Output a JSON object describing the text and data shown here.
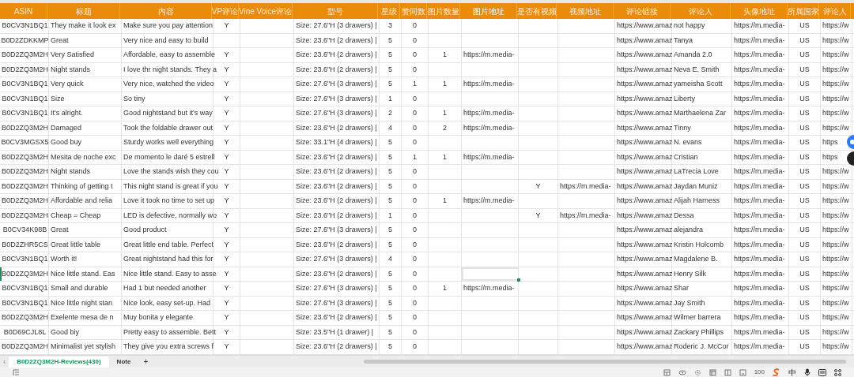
{
  "columns": [
    {
      "label": "ASIN",
      "selected": false
    },
    {
      "label": "标题",
      "selected": false
    },
    {
      "label": "内容",
      "selected": false
    },
    {
      "label": "VP评论",
      "selected": false
    },
    {
      "label": "Vine Voice评论",
      "selected": false
    },
    {
      "label": "型号",
      "selected": false
    },
    {
      "label": "星级",
      "selected": false
    },
    {
      "label": "赞同数",
      "selected": false
    },
    {
      "label": "图片数量",
      "selected": false
    },
    {
      "label": "图片地址",
      "selected": true
    },
    {
      "label": "是否有视频",
      "selected": false
    },
    {
      "label": "视频地址",
      "selected": false
    },
    {
      "label": "评论链接",
      "selected": false
    },
    {
      "label": "评论人",
      "selected": false
    },
    {
      "label": "头像地址",
      "selected": false
    },
    {
      "label": "所属国家",
      "selected": false
    },
    {
      "label": "评论人",
      "selected": false
    }
  ],
  "rows": [
    {
      "selected": false,
      "cells": [
        "B0CV3N1BQ1",
        "They make it look ex",
        "Make sure you pay attention",
        "Y",
        "",
        "Size: 27.6\"H (3 drawers) |",
        "3",
        "0",
        "",
        "",
        "",
        "",
        "https://www.amaz",
        "not happy",
        "https://m.media-",
        "US",
        "https://w"
      ]
    },
    {
      "selected": false,
      "cells": [
        "B0D2ZDKKMP",
        "Great",
        "Very nice and easy to build",
        "",
        "",
        "Size: 23.6\"H (2 drawers) |",
        "5",
        "0",
        "",
        "",
        "",
        "",
        "https://www.amaz",
        "Tanya",
        "https://m.media-",
        "US",
        "https://w"
      ]
    },
    {
      "selected": false,
      "cells": [
        "B0D2ZQ3M2H",
        "Very Satisfied",
        "Affordable, easy to assemble",
        "Y",
        "",
        "Size: 23.6\"H (2 drawers) |",
        "5",
        "0",
        "1",
        "https://m.media-",
        "",
        "",
        "https://www.amaz",
        "Amanda 2.0",
        "https://m.media-",
        "US",
        "https://w"
      ]
    },
    {
      "selected": false,
      "cells": [
        "B0D2ZQ3M2H",
        "Night stands",
        "I love thr night stands. They a",
        "Y",
        "",
        "Size: 23.6\"H (2 drawers) |",
        "5",
        "0",
        "",
        "",
        "",
        "",
        "https://www.amaz",
        "Neva E. Smith",
        "https://m.media-",
        "US",
        "https://w"
      ]
    },
    {
      "selected": false,
      "cells": [
        "B0CV3N1BQ1",
        "Very quick",
        "Very nice, watched the video",
        "Y",
        "",
        "Size: 27.6\"H (3 drawers) |",
        "5",
        "1",
        "1",
        "https://m.media-",
        "",
        "",
        "https://www.amaz",
        "yameisha Scott",
        "https://m.media-",
        "US",
        "https://w"
      ]
    },
    {
      "selected": false,
      "cells": [
        "B0CV3N1BQ1",
        "Size",
        "So tiny",
        "Y",
        "",
        "Size: 27.6\"H (3 drawers) |",
        "1",
        "0",
        "",
        "",
        "",
        "",
        "https://www.amaz",
        "Liberty",
        "https://m.media-",
        "US",
        "https://w"
      ]
    },
    {
      "selected": false,
      "cells": [
        "B0CV3N1BQ1",
        "It's alright.",
        "Good nightstand but it's way",
        "Y",
        "",
        "Size: 27.6\"H (3 drawers) |",
        "2",
        "0",
        "1",
        "https://m.media-",
        "",
        "",
        "https://www.amaz",
        "Marthaelena Zar",
        "https://m.media-",
        "US",
        "https://w"
      ]
    },
    {
      "selected": false,
      "cells": [
        "B0D2ZQ3M2H",
        "Damaged",
        "Took the foldable drawer out",
        "Y",
        "",
        "Size: 23.6\"H (2 drawers) |",
        "4",
        "0",
        "2",
        "https://m.media-",
        "",
        "",
        "https://www.amaz",
        "Tinny",
        "https://m.media-",
        "US",
        "https://w"
      ]
    },
    {
      "selected": false,
      "cells": [
        "B0CV3MGSX5",
        "Good buy",
        "Sturdy works well everything",
        "Y",
        "",
        "Size: 33.1\"H (4 drawers) |",
        "5",
        "0",
        "",
        "",
        "",
        "",
        "https://www.amaz",
        "N. evans",
        "https://m.media-",
        "US",
        "https"
      ]
    },
    {
      "selected": false,
      "cells": [
        "B0D2ZQ3M2H",
        "Mesita de noche exc",
        "De momento le daré 5 estrell",
        "Y",
        "",
        "Size: 23.6\"H (2 drawers) |",
        "5",
        "1",
        "1",
        "https://m.media-",
        "",
        "",
        "https://www.amaz",
        "Cristian",
        "https://m.media-",
        "US",
        "https"
      ]
    },
    {
      "selected": false,
      "cells": [
        "B0D2ZQ3M2H",
        "Night stands",
        "Love the stands wish they cou",
        "Y",
        "",
        "Size: 23.6\"H (2 drawers) |",
        "5",
        "0",
        "",
        "",
        "",
        "",
        "https://www.amaz",
        "LaTrecia Love",
        "https://m.media-",
        "US",
        "https://w"
      ]
    },
    {
      "selected": false,
      "cells": [
        "B0D2ZQ3M2H",
        "Thinking of getting t",
        "This night stand is great if you",
        "Y",
        "",
        "Size: 23.6\"H (2 drawers) |",
        "5",
        "0",
        "",
        "",
        "Y",
        "https://m.media-",
        "https://www.amaz",
        "Jaydan Muniz",
        "https://m.media-",
        "US",
        "https://w"
      ]
    },
    {
      "selected": false,
      "cells": [
        "B0D2ZQ3M2H",
        "Affordable and relia",
        "Love it took no time to set up",
        "Y",
        "",
        "Size: 23.6\"H (2 drawers) |",
        "5",
        "0",
        "1",
        "https://m.media-",
        "",
        "",
        "https://www.amaz",
        "Alijah Harness",
        "https://m.media-",
        "US",
        "https://w"
      ]
    },
    {
      "selected": false,
      "cells": [
        "B0D2ZQ3M2H",
        "Cheap = Cheap",
        "LED is defective, normally wo",
        "Y",
        "",
        "Size: 23.6\"H (2 drawers) |",
        "1",
        "0",
        "",
        "",
        "Y",
        "https://m.media-",
        "https://www.amaz",
        "Dessa",
        "https://m.media-",
        "US",
        "https://w"
      ]
    },
    {
      "selected": false,
      "cells": [
        "B0CV34K98B",
        "Great",
        "Good product",
        "Y",
        "",
        "Size: 27.6\"H (3 drawers) |",
        "5",
        "0",
        "",
        "",
        "",
        "",
        "https://www.amaz",
        "alejandra",
        "https://m.media-",
        "US",
        "https://w"
      ]
    },
    {
      "selected": false,
      "cells": [
        "B0D2ZHR5CS",
        "Great little table",
        "Great little end table. Perfect",
        "Y",
        "",
        "Size: 23.6\"H (2 drawers) |",
        "5",
        "0",
        "",
        "",
        "",
        "",
        "https://www.amaz",
        "Kristin Holcomb",
        "https://m.media-",
        "US",
        "https://w"
      ]
    },
    {
      "selected": false,
      "cells": [
        "B0CV3N1BQ1",
        "Worth it!",
        "Great nightstand had this for",
        "Y",
        "",
        "Size: 27.6\"H (3 drawers) |",
        "4",
        "0",
        "",
        "",
        "",
        "",
        "https://www.amaz",
        "Magdalene B.",
        "https://m.media-",
        "US",
        "https://w"
      ]
    },
    {
      "selected": true,
      "cells": [
        "B0D2ZQ3M2H",
        "Nice little stand. Eas",
        "Nice little stand. Easy to asse",
        "Y",
        "",
        "Size: 23.6\"H (2 drawers) |",
        "5",
        "0",
        "",
        "",
        "",
        "",
        "https://www.amaz",
        "Henry Silk",
        "https://m.media-",
        "US",
        "https://w"
      ]
    },
    {
      "selected": false,
      "cells": [
        "B0CV3N1BQ1",
        "Small and durable",
        "Had 1 but needed another",
        "Y",
        "",
        "Size: 27.6\"H (3 drawers) |",
        "5",
        "0",
        "1",
        "https://m.media-",
        "",
        "",
        "https://www.amaz",
        "Shar",
        "https://m.media-",
        "US",
        "https://w"
      ]
    },
    {
      "selected": false,
      "cells": [
        "B0CV3N1BQ1",
        "Nice little night stan",
        "Nice look, easy set-up. Had",
        "Y",
        "",
        "Size: 27.6\"H (3 drawers) |",
        "5",
        "0",
        "",
        "",
        "",
        "",
        "https://www.amaz",
        "Jay Smith",
        "https://m.media-",
        "US",
        "https://w"
      ]
    },
    {
      "selected": false,
      "cells": [
        "B0D2ZQ3M2H",
        "Exelente mesa de n",
        "Muy bonita y elegante",
        "Y",
        "",
        "Size: 23.6\"H (2 drawers) |",
        "5",
        "0",
        "",
        "",
        "",
        "",
        "https://www.amaz",
        "Wilmer barrera",
        "https://m.media-",
        "US",
        "https://w"
      ]
    },
    {
      "selected": false,
      "cells": [
        "B0D69CJL8L",
        "Good biy",
        "Pretty easy to assemble. Bett",
        "Y",
        "",
        "Size: 23.5\"H (1 drawer) |",
        "5",
        "0",
        "",
        "",
        "",
        "",
        "https://www.amaz",
        "Zackary Phillips",
        "https://m.media-",
        "US",
        "https://w"
      ]
    },
    {
      "selected": false,
      "cells": [
        "B0D2ZQ3M2H",
        "Minimalist yet stylish",
        "They give you extra screws f",
        "Y",
        "",
        "Size: 23.6\"H (2 drawers) |",
        "5",
        "0",
        "",
        "",
        "",
        "",
        "https://www.amaz",
        "Roderic J. McCor",
        "https://m.media-",
        "US",
        "https://w"
      ]
    }
  ],
  "sheet_tabs": [
    {
      "label": "B0D2ZQ3M2H-Reviews(430)",
      "selected": true
    },
    {
      "label": "Note",
      "selected": false
    }
  ],
  "scroll_left": "‹",
  "add_sheet": "+",
  "status_bar": {
    "zoom": "100",
    "ime": "中"
  }
}
